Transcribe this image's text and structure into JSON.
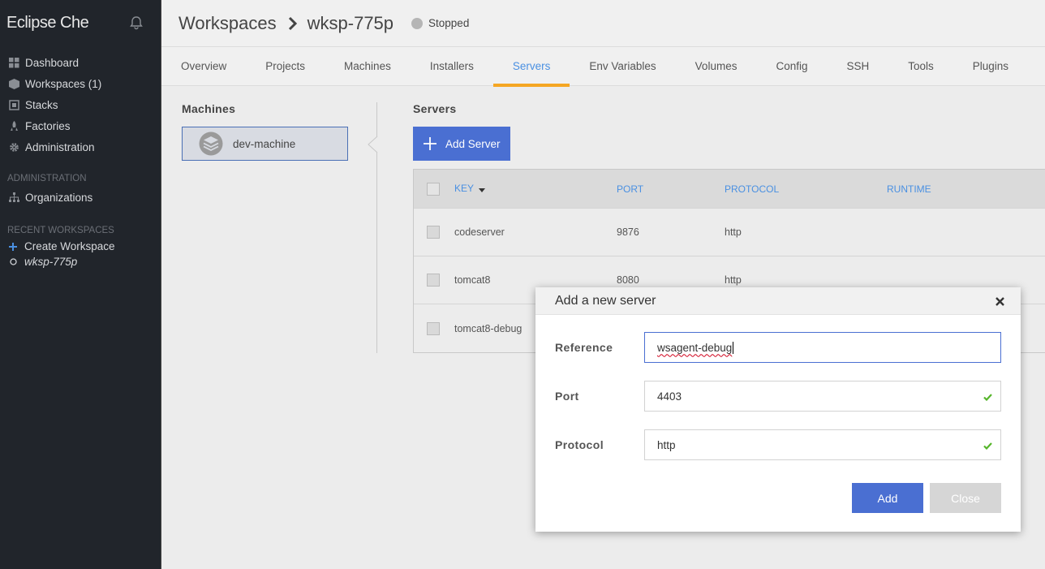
{
  "sidebar": {
    "logo": "Eclipse Che",
    "nav": [
      {
        "label": "Dashboard",
        "icon": "dashboard-icon"
      },
      {
        "label": "Workspaces (1)",
        "icon": "workspaces-icon"
      },
      {
        "label": "Stacks",
        "icon": "stacks-icon"
      },
      {
        "label": "Factories",
        "icon": "factories-icon"
      },
      {
        "label": "Administration",
        "icon": "gear-icon"
      }
    ],
    "admin_section": "ADMINISTRATION",
    "organizations": "Organizations",
    "recent_section": "RECENT WORKSPACES",
    "create_workspace": "Create Workspace",
    "recent_workspace": "wksp-775p"
  },
  "header": {
    "crumb": "Workspaces",
    "workspace": "wksp-775p",
    "status": "Stopped"
  },
  "tabs": [
    {
      "label": "Overview",
      "active": false
    },
    {
      "label": "Projects",
      "active": false
    },
    {
      "label": "Machines",
      "active": false
    },
    {
      "label": "Installers",
      "active": false
    },
    {
      "label": "Servers",
      "active": true
    },
    {
      "label": "Env Variables",
      "active": false
    },
    {
      "label": "Volumes",
      "active": false
    },
    {
      "label": "Config",
      "active": false
    },
    {
      "label": "SSH",
      "active": false
    },
    {
      "label": "Tools",
      "active": false
    },
    {
      "label": "Plugins",
      "active": false
    }
  ],
  "machines": {
    "title": "Machines",
    "selected": "dev-machine"
  },
  "servers": {
    "title": "Servers",
    "add_button": "Add Server",
    "columns": {
      "key": "KEY",
      "port": "PORT",
      "protocol": "PROTOCOL",
      "runtime": "RUNTIME"
    },
    "rows": [
      {
        "key": "codeserver",
        "port": "9876",
        "protocol": "http",
        "runtime": ""
      },
      {
        "key": "tomcat8",
        "port": "8080",
        "protocol": "http",
        "runtime": ""
      },
      {
        "key": "tomcat8-debug",
        "port": "",
        "protocol": "",
        "runtime": ""
      }
    ]
  },
  "dialog": {
    "title": "Add a new server",
    "reference_label": "Reference",
    "reference_value": "wsagent-debug",
    "port_label": "Port",
    "port_value": "4403",
    "protocol_label": "Protocol",
    "protocol_value": "http",
    "add_button": "Add",
    "close_button": "Close"
  },
  "colors": {
    "sidebar_bg": "#21252b",
    "accent_blue": "#4a6fd2",
    "tab_active": "#4a90e2",
    "tab_underline": "#f5a623",
    "valid_check": "#55b52a"
  }
}
